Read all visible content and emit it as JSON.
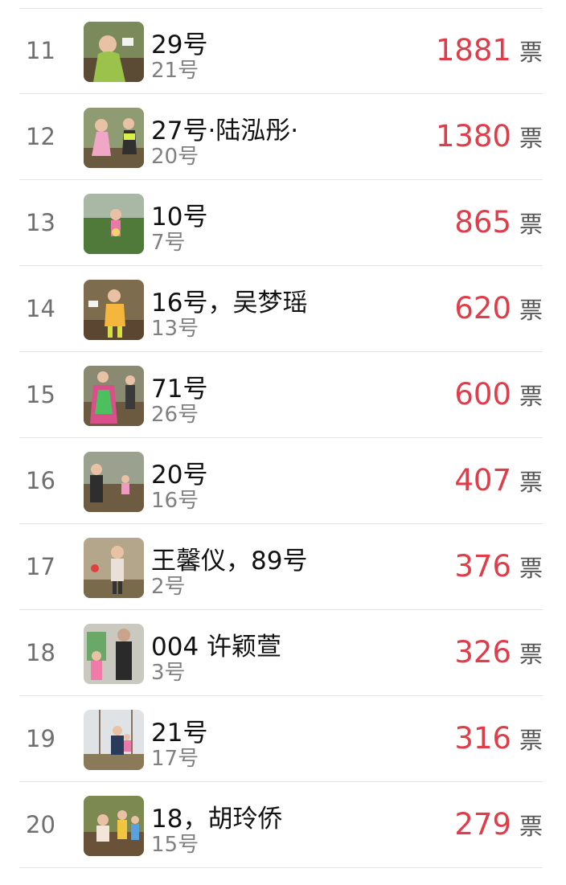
{
  "ranking": {
    "rows": [
      {
        "rank": "11",
        "title": "29号",
        "sub": "21号",
        "votes": "1881",
        "unit": "票"
      },
      {
        "rank": "12",
        "title": "27号·陆泓彤·",
        "sub": "20号",
        "votes": "1380",
        "unit": "票"
      },
      {
        "rank": "13",
        "title": "10号",
        "sub": "7号",
        "votes": "865",
        "unit": "票"
      },
      {
        "rank": "14",
        "title": "16号，吴梦瑶",
        "sub": "13号",
        "votes": "620",
        "unit": "票"
      },
      {
        "rank": "15",
        "title": "71号",
        "sub": "26号",
        "votes": "600",
        "unit": "票"
      },
      {
        "rank": "16",
        "title": "20号",
        "sub": "16号",
        "votes": "407",
        "unit": "票"
      },
      {
        "rank": "17",
        "title": "王馨仪，89号",
        "sub": "2号",
        "votes": "376",
        "unit": "票"
      },
      {
        "rank": "18",
        "title": "004 许颖萱",
        "sub": "3号",
        "votes": "326",
        "unit": "票"
      },
      {
        "rank": "19",
        "title": "21号",
        "sub": "17号",
        "votes": "316",
        "unit": "票"
      },
      {
        "rank": "20",
        "title": "18，胡玲侨",
        "sub": "15号",
        "votes": "279",
        "unit": "票"
      }
    ]
  },
  "colors": {
    "vote_number": "#e03d4a",
    "rank": "#6f6f6f",
    "subtitle": "#808080",
    "divider": "#e3e3e3"
  }
}
